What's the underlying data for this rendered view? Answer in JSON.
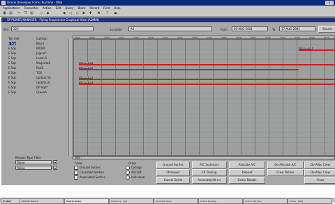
{
  "window": {
    "title": "Oracle Developer Forms Runtime - Web"
  },
  "menu": [
    "Applications",
    "Favourites",
    "Action",
    "Edit",
    "Query",
    "Block",
    "Record",
    "Field",
    "Help"
  ],
  "inner_title": "SP POWER MANAGER - Flying Programme Graphical View (ADMIN)",
  "filters": {
    "unit_label": "Unit",
    "unit_value": "22C",
    "location_label": "Location",
    "location_value": "All",
    "from_label": "From",
    "from_value": "05-AUG-2001",
    "to_label": "To",
    "to_value": "17-AUG-2001",
    "search_label": "Search"
  },
  "columns": {
    "tail": "Tail Unit",
    "callsign": "Callsign"
  },
  "timeline_ticks": [
    "0800",
    "0900",
    "1000",
    "1100",
    "1200",
    "1300",
    "1400",
    "1500",
    "1600",
    "1700",
    "1800",
    "1900",
    "2000",
    "2100",
    "2200",
    "2300",
    "0000",
    "0100"
  ],
  "rows": [
    {
      "tail": "E Sqn",
      "callsign": "Blue1"
    },
    {
      "tail": "E Sqn",
      "callsign": "PROM"
    },
    {
      "tail": "E Sqn",
      "callsign": "Jaguar*"
    },
    {
      "tail": "E Sqn",
      "callsign": "Lozani1"
    },
    {
      "tail": "E Sqn",
      "callsign": "Magenta8"
    },
    {
      "tail": "E Sqn",
      "callsign": "Red2"
    },
    {
      "tail": "E Sqn",
      "callsign": "TO2"
    },
    {
      "tail": "E Sqn",
      "callsign": "Update 1A"
    },
    {
      "tail": "E Sqn",
      "callsign": "Update 2L"
    },
    {
      "tail": "E Sqn",
      "callsign": "DP Sqd*"
    },
    {
      "tail": "E Sqn",
      "callsign": "GreenA"
    }
  ],
  "sorties": [
    {
      "row": 1,
      "start": 0.86,
      "end": 1.0,
      "label": "1 0903E N 2"
    },
    {
      "row": 4,
      "start": 0.02,
      "end": 1.0,
      "label": "1 0903E N 2"
    },
    {
      "row": 5,
      "start": 0.02,
      "end": 0.86,
      "label": "1 0903E N 2"
    },
    {
      "row": 7,
      "start": 0.02,
      "end": 1.0,
      "label": "1 0903E N 2"
    },
    {
      "row": 8,
      "start": 0.02,
      "end": 1.0,
      "label": "1 0903E N 2"
    }
  ],
  "mission_type_filter": {
    "title": "Mission Type Filter",
    "field1": "None",
    "field2": "None"
  },
  "view": {
    "title": "View",
    "options": [
      "Ground Sorties",
      "Cancelled Sorties",
      "Associated Sorties"
    ]
  },
  "order": {
    "title": "Order",
    "options": [
      "Callsign",
      "Aircraft",
      "Individual"
    ]
  },
  "buttons": {
    "row1": [
      "Ground Sorties",
      "A/C Summary",
      "Allocate A/C",
      "De-Allocate A/C",
      "De-Alloc Crew"
    ],
    "row2": [
      "FP Report",
      "FP Tasking",
      "Debrief",
      "Crew Details",
      "De-Alloc Crew"
    ],
    "row3": [
      "Cancel Sortie",
      "Associate(Alt+c)",
      "Sortie Details",
      "Close"
    ]
  },
  "taskbar": {
    "start": "Start",
    "tasks": [
      "PROOM: Netsca",
      "Oracle Devel",
      "Exploring - spal",
      "Microsoft Visua",
      "Oracle Develop",
      "Oracle SQL Plus",
      "Calcul - Note"
    ]
  },
  "colors": {
    "sortie_bar": "#d21a1a",
    "title_bar": "#0a2a7a",
    "client_bg": "#a8a8a8"
  }
}
